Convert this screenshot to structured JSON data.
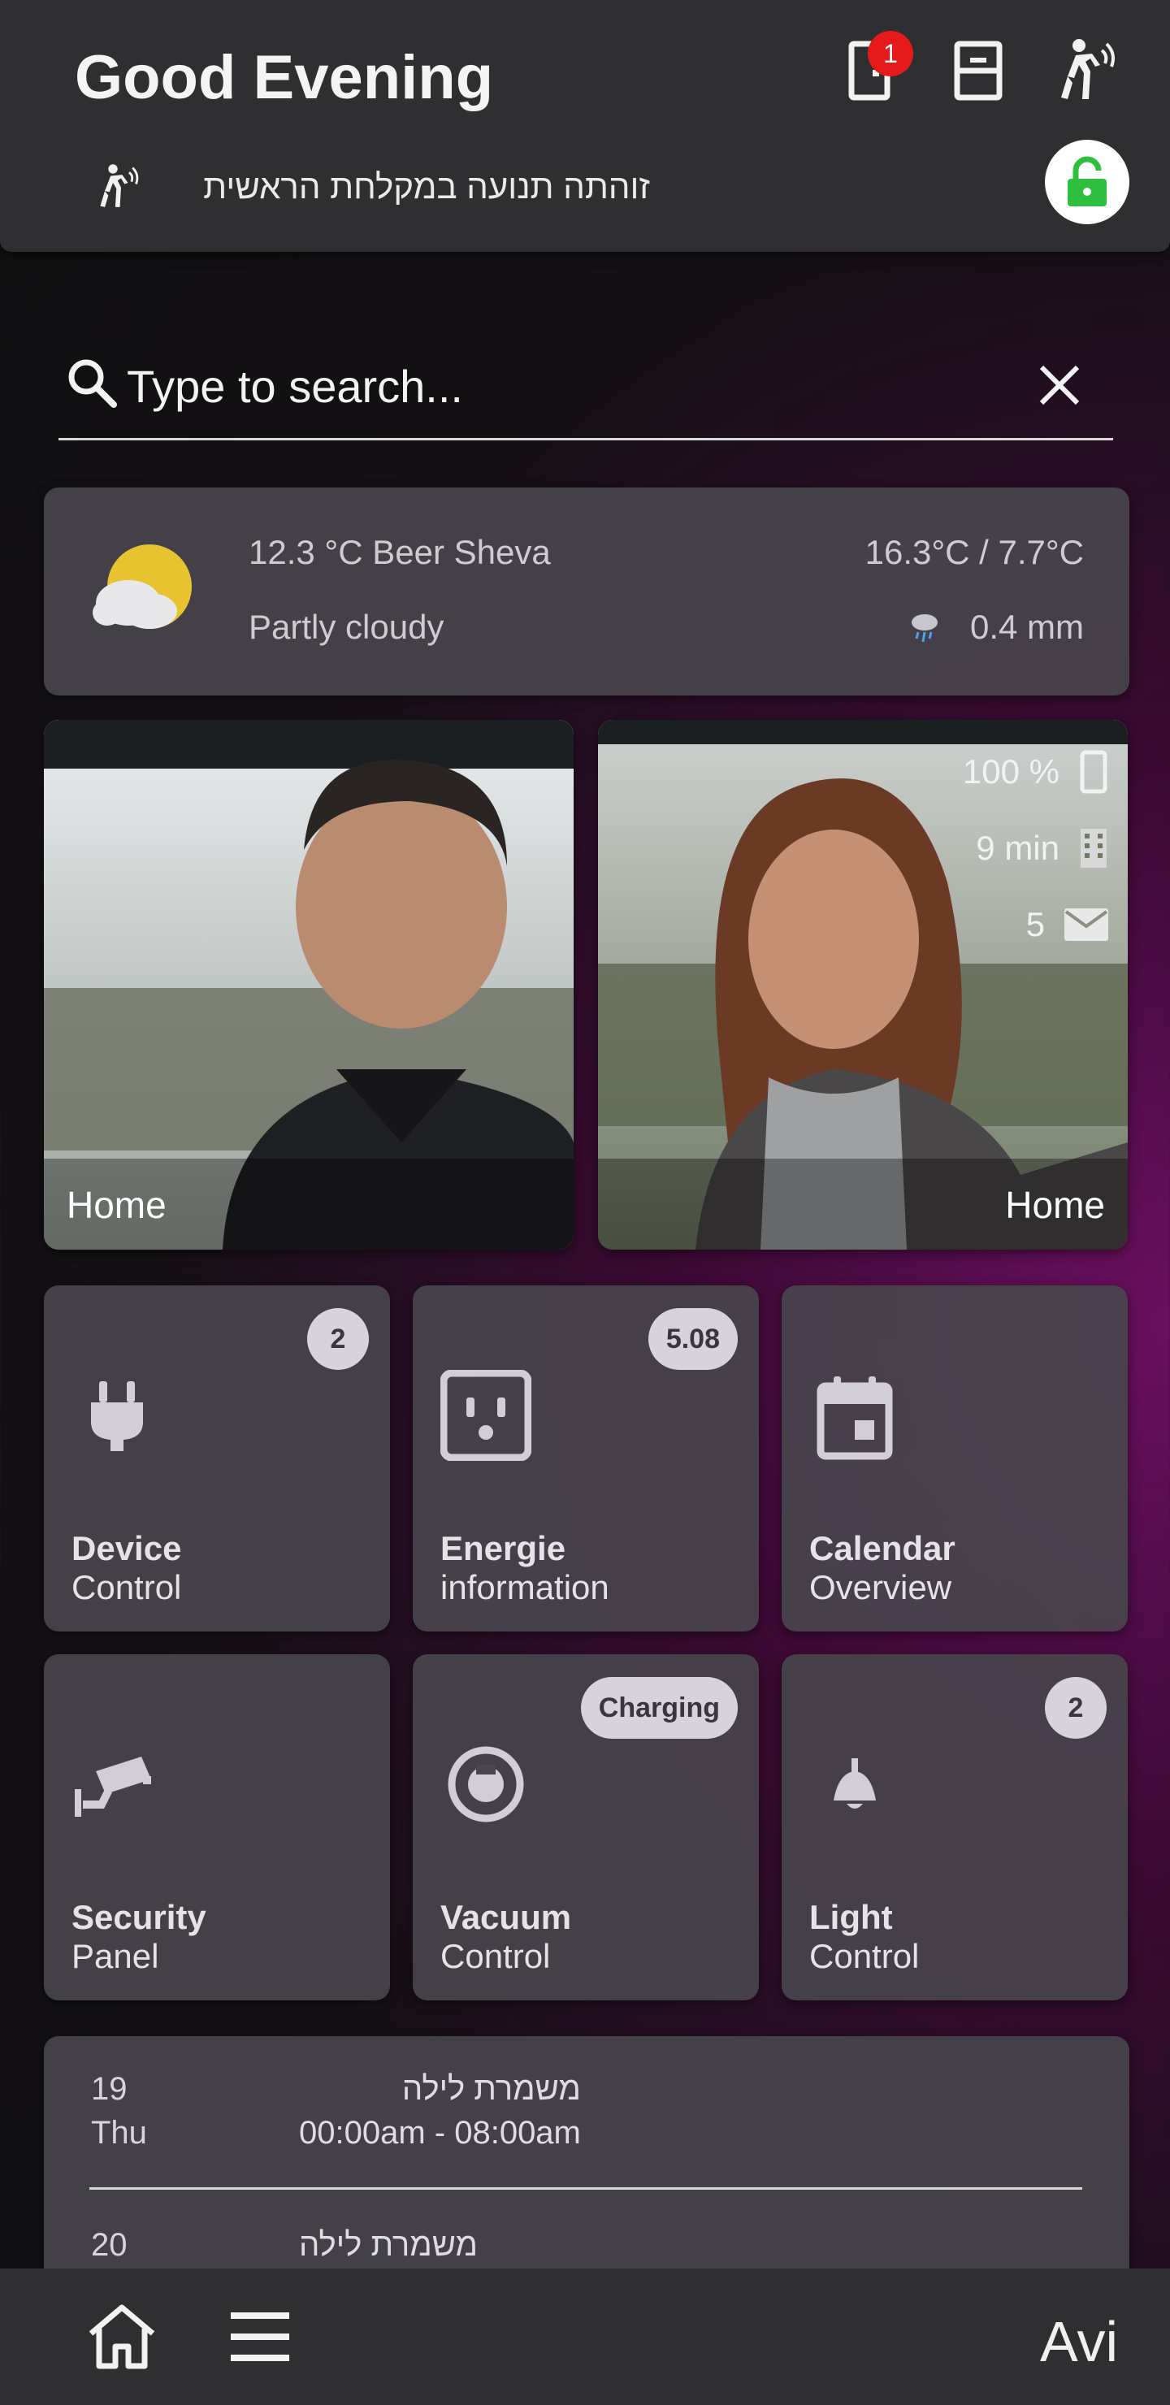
{
  "header": {
    "greeting": "Good Evening",
    "notification_count": "1",
    "motion_text": "זוהתה תנועה במקלחת הראשית"
  },
  "search": {
    "placeholder": "Type to search..."
  },
  "weather": {
    "current": "12.3 °C Beer Sheva",
    "condition": "Partly cloudy",
    "range": "16.3°C / 7.7°C",
    "precipitation": "0.4 mm"
  },
  "persons": [
    {
      "location": "Home"
    },
    {
      "location": "Home",
      "battery": "100 %",
      "travel": "9 min",
      "messages": "5"
    }
  ],
  "tiles": [
    {
      "title": "Device",
      "subtitle": "Control",
      "badge": "2",
      "icon": "plug-icon"
    },
    {
      "title": "Energie",
      "subtitle": "information",
      "badge": "5.08",
      "icon": "power-outlet-icon"
    },
    {
      "title": "Calendar",
      "subtitle": "Overview",
      "icon": "calendar-icon"
    },
    {
      "title": "Security",
      "subtitle": "Panel",
      "icon": "cctv-icon"
    },
    {
      "title": "Vacuum",
      "subtitle": "Control",
      "badge": "Charging",
      "icon": "robot-vacuum-icon"
    },
    {
      "title": "Light",
      "subtitle": "Control",
      "badge": "2",
      "icon": "ceiling-light-icon"
    }
  ],
  "calendar": [
    {
      "day": "19",
      "weekday": "Thu",
      "title": "משמרת לילה",
      "time": "00:00am - 08:00am"
    },
    {
      "day": "20",
      "title": "משמרת לילה"
    }
  ],
  "bottom_nav": {
    "user": "Avi"
  },
  "colors": {
    "accent": "#6a0f5e",
    "lock": "#2fbf3f",
    "badge_red": "#e61a1a"
  }
}
